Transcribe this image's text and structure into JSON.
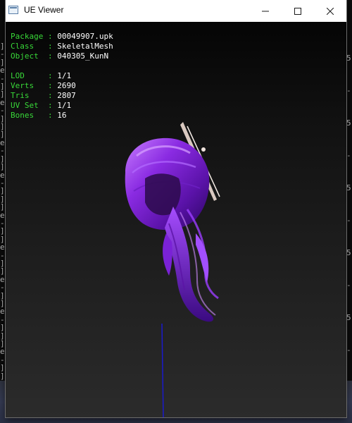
{
  "window": {
    "title": "UE Viewer",
    "icon": "app-window-icon"
  },
  "controls": {
    "minimize_icon": "minimize-icon",
    "maximize_icon": "maximize-icon",
    "close_icon": "close-icon"
  },
  "info": {
    "package_label": "Package",
    "package_value": "00049907.upk",
    "class_label": "Class  ",
    "class_value": "SkeletalMesh",
    "object_label": "Object ",
    "object_value": "040305_KunN",
    "lod_label": "LOD    ",
    "lod_value": "1/1",
    "verts_label": "Verts  ",
    "verts_value": "2690",
    "tris_label": "Tris   ",
    "tris_value": "2807",
    "uvset_label": "UV Set ",
    "uvset_value": "1/1",
    "bones_label": "Bones  ",
    "bones_value": "16",
    "separator": ": "
  },
  "background": {
    "left_glyphs": [
      "]",
      "-",
      "]",
      "e",
      "-",
      "]",
      "]",
      "e",
      "-",
      "]",
      "]",
      "]",
      "e",
      "-",
      "]",
      "]",
      "e",
      "-",
      "]",
      "]",
      "]",
      "e",
      "-",
      "]",
      "]",
      "e",
      "-",
      "]",
      "]",
      "e",
      "-",
      "]",
      "]",
      "e",
      "-",
      "]",
      "]",
      "]",
      "e",
      "-",
      "]",
      "]"
    ],
    "right_glyphs": [
      "5",
      "-",
      "5",
      "-",
      "5",
      "-",
      "5",
      "-",
      "5",
      "-"
    ]
  },
  "colors": {
    "label_green": "#38d838",
    "value_white": "#ffffff",
    "hair_purple": "#8a2be2",
    "axis_blue": "#1a1acc"
  }
}
